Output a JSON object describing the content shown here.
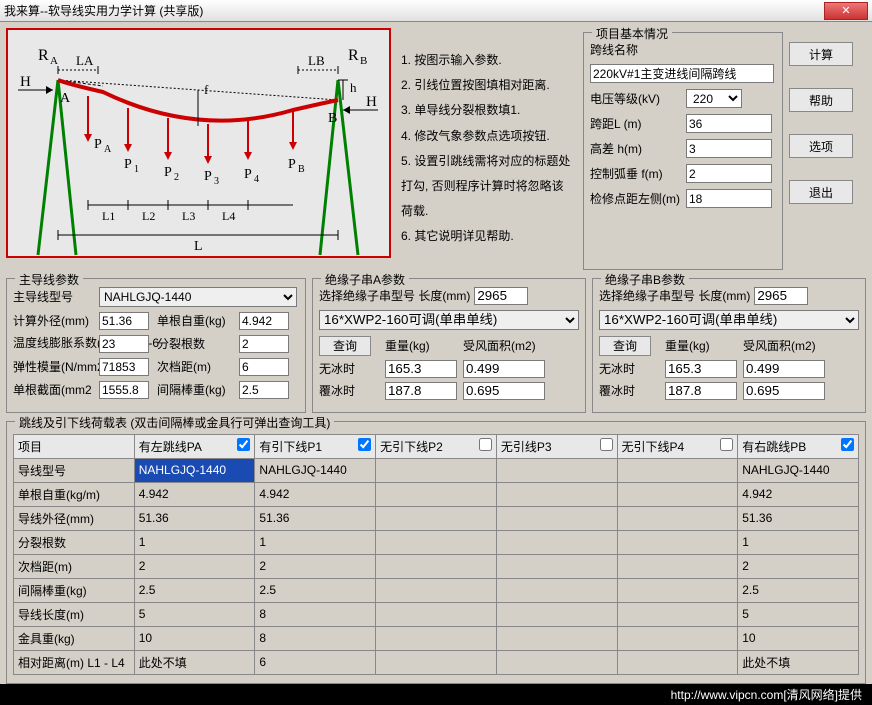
{
  "window": {
    "title": "我来算--软导线实用力学计算 (共享版)"
  },
  "instructions": [
    "1. 按图示输入参数.",
    "2. 引线位置按图填相对距离.",
    "3. 单导线分裂根数填1.",
    "4. 修改气象参数点选项按钮.",
    "5. 设置引跳线需将对应的标题处打勾, 否则程序计算时将忽略该荷载.",
    "6. 其它说明详见帮助."
  ],
  "project": {
    "legend": "项目基本情况",
    "name_label": "跨线名称",
    "name_value": "220kV#1主变进线间隔跨线",
    "voltage_label": "电压等级(kV)",
    "voltage_value": "220",
    "span_label": "跨距L (m)",
    "span_value": "36",
    "height_label": "高差 h(m)",
    "height_value": "3",
    "sag_label": "控制弧垂 f(m)",
    "sag_value": "2",
    "maint_label": "检修点距左侧(m)",
    "maint_value": "18"
  },
  "buttons": {
    "calc": "计算",
    "help": "帮助",
    "options": "选项",
    "exit": "退出"
  },
  "main_wire": {
    "legend": "主导线参数",
    "model_label": "主导线型号",
    "model_value": "NAHLGJQ-1440",
    "outer_dia_label": "计算外径(mm)",
    "outer_dia_value": "51.36",
    "self_weight_label": "单根自重(kg)",
    "self_weight_value": "4.942",
    "expansion_label": "温度线膨胀系数(1/℃)10E-6",
    "expansion_value": "23",
    "split_label": "分裂根数",
    "split_value": "2",
    "elastic_label": "弹性模量(N/mm2)",
    "elastic_value": "71853",
    "sub_span_label": "次档距(m)",
    "sub_span_value": "6",
    "cross_section_label": "单根截面(mm2",
    "cross_section_value": "1555.8",
    "spacer_label": "间隔棒重(kg)",
    "spacer_value": "2.5"
  },
  "insul_a": {
    "legend": "绝缘子串A参数",
    "header": "选择绝缘子串型号  长度(mm)",
    "length": "2965",
    "select": "16*XWP2-160可调(单串单线)",
    "query": "查询",
    "weight_label": "重量(kg)",
    "wind_label": "受风面积(m2)",
    "noice_label": "无冰时",
    "noice_weight": "165.3",
    "noice_wind": "0.499",
    "ice_label": "覆冰时",
    "ice_weight": "187.8",
    "ice_wind": "0.695"
  },
  "insul_b": {
    "legend": "绝缘子串B参数",
    "header": "选择绝缘子串型号  长度(mm)",
    "length": "2965",
    "select": "16*XWP2-160可调(单串单线)",
    "query": "查询",
    "weight_label": "重量(kg)",
    "wind_label": "受风面积(m2)",
    "noice_label": "无冰时",
    "noice_weight": "165.3",
    "noice_wind": "0.499",
    "ice_label": "覆冰时",
    "ice_weight": "187.8",
    "ice_wind": "0.695"
  },
  "load_table": {
    "legend": "跳线及引下线荷载表 (双击间隔棒或金具行可弹出查询工具)",
    "headers": [
      "项目",
      "有左跳线PA",
      "有引下线P1",
      "无引下线P2",
      "无引线P3",
      "无引下线P4",
      "有右跳线PB"
    ],
    "checked": [
      false,
      true,
      true,
      false,
      false,
      false,
      true
    ],
    "rows": [
      {
        "label": "导线型号",
        "cells": [
          "NAHLGJQ-1440",
          "NAHLGJQ-1440",
          "",
          "",
          "",
          "NAHLGJQ-1440"
        ]
      },
      {
        "label": "单根自重(kg/m)",
        "cells": [
          "4.942",
          "4.942",
          "",
          "",
          "",
          "4.942"
        ]
      },
      {
        "label": "导线外径(mm)",
        "cells": [
          "51.36",
          "51.36",
          "",
          "",
          "",
          "51.36"
        ]
      },
      {
        "label": "分裂根数",
        "cells": [
          "1",
          "1",
          "",
          "",
          "",
          "1"
        ]
      },
      {
        "label": "次档距(m)",
        "cells": [
          "2",
          "2",
          "",
          "",
          "",
          "2"
        ]
      },
      {
        "label": "间隔棒重(kg)",
        "cells": [
          "2.5",
          "2.5",
          "",
          "",
          "",
          "2.5"
        ]
      },
      {
        "label": "导线长度(m)",
        "cells": [
          "5",
          "8",
          "",
          "",
          "",
          "5"
        ]
      },
      {
        "label": "金具重(kg)",
        "cells": [
          "10",
          "8",
          "",
          "",
          "",
          "10"
        ]
      },
      {
        "label": "相对距离(m) L1 - L4",
        "cells": [
          "此处不填",
          "6",
          "",
          "",
          "",
          "此处不填"
        ]
      }
    ]
  },
  "footer": "http://www.vipcn.com[清风网络]提供"
}
